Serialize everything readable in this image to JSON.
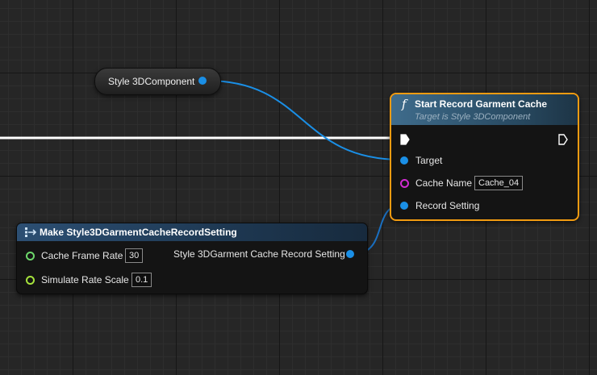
{
  "variable_node": {
    "label": "Style 3DComponent"
  },
  "function_node": {
    "icon": "f",
    "title": "Start Record Garment Cache",
    "subtitle": "Target is Style 3DComponent",
    "pins": {
      "target": "Target",
      "cache_name": "Cache Name",
      "cache_name_value": "Cache_04",
      "record_setting": "Record Setting"
    }
  },
  "make_node": {
    "title": "Make Style3DGarmentCacheRecordSetting",
    "pins": {
      "cache_frame_rate": "Cache Frame Rate",
      "cache_frame_rate_value": "30",
      "simulate_rate_scale": "Simulate Rate Scale",
      "simulate_rate_scale_value": "0.1",
      "output": "Style 3DGarment Cache Record Setting"
    }
  },
  "colors": {
    "object_pin": "#1a8fe6",
    "string_pin": "#d22bd2",
    "int_pin": "#6dd86b",
    "float_pin": "#a6e33c",
    "selection": "#f29b11",
    "exec_wire": "#ffffff"
  },
  "icons": [
    "function-icon",
    "make-struct-icon",
    "exec-in-icon",
    "exec-out-icon"
  ]
}
